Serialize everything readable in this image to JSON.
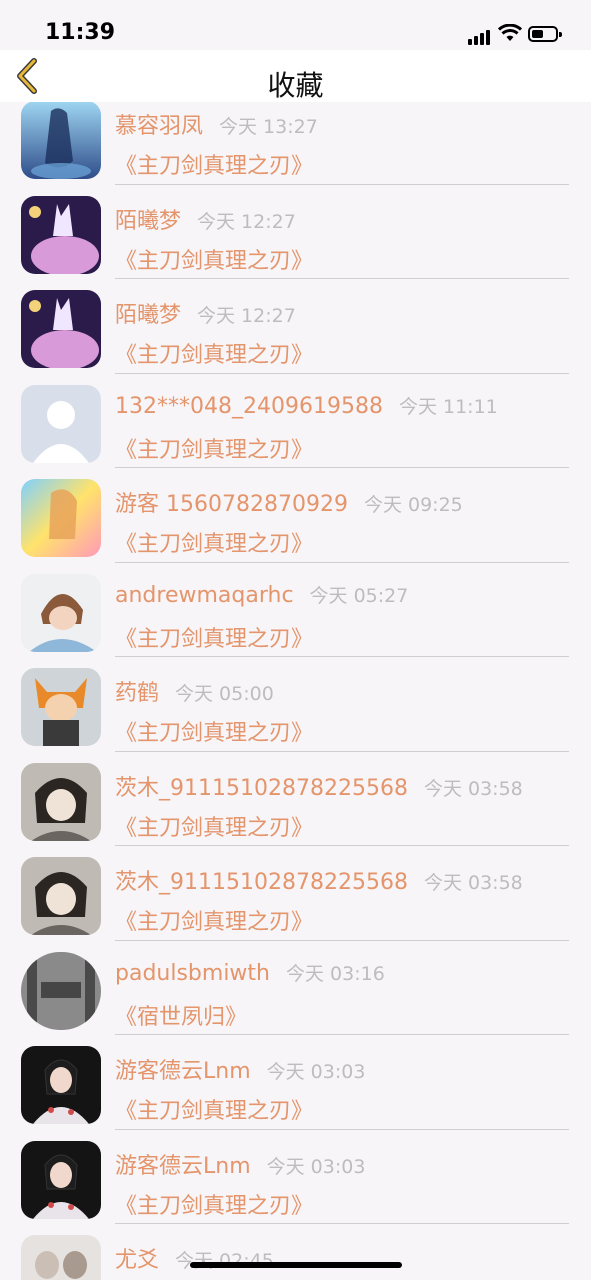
{
  "status_bar": {
    "time": "11:39"
  },
  "nav": {
    "title": "收藏",
    "back_icon": "chevron-left-icon",
    "accent": "#e8b83a"
  },
  "colors": {
    "name": "#e4956b",
    "time": "#bdbdbd",
    "background": "#f7f5f8"
  },
  "favorites": [
    {
      "user": "慕容羽凤",
      "time": "今天 13:27",
      "title": "《主刀剑真理之刃》"
    },
    {
      "user": "陌曦梦",
      "time": "今天 12:27",
      "title": "《主刀剑真理之刃》"
    },
    {
      "user": "陌曦梦",
      "time": "今天 12:27",
      "title": "《主刀剑真理之刃》"
    },
    {
      "user": "132***048_2409619588",
      "time": "今天 11:11",
      "title": "《主刀剑真理之刃》"
    },
    {
      "user": "游客 1560782870929",
      "time": "今天 09:25",
      "title": "《主刀剑真理之刃》"
    },
    {
      "user": "andrewmaqarhc",
      "time": "今天 05:27",
      "title": "《主刀剑真理之刃》"
    },
    {
      "user": "药鹤",
      "time": "今天 05:00",
      "title": "《主刀剑真理之刃》"
    },
    {
      "user": "茨木_9111510287822556​8",
      "time": "今天 03:58",
      "title": "《主刀剑真理之刃》"
    },
    {
      "user": "茨木_91115102878225568",
      "time": "今天 03:58",
      "title": "《主刀剑真理之刃》"
    },
    {
      "user": "padulsbmiwth",
      "time": "今天 03:16",
      "title": "《宿世夙归》"
    },
    {
      "user": "游客德云Lnm",
      "time": "今天 03:03",
      "title": "《主刀剑真理之刃》"
    },
    {
      "user": "游客德云Lnm",
      "time": "今天 03:03",
      "title": "《主刀剑真理之刃》"
    },
    {
      "user": "尤爻",
      "time": "今天 02:45",
      "title": ""
    }
  ]
}
